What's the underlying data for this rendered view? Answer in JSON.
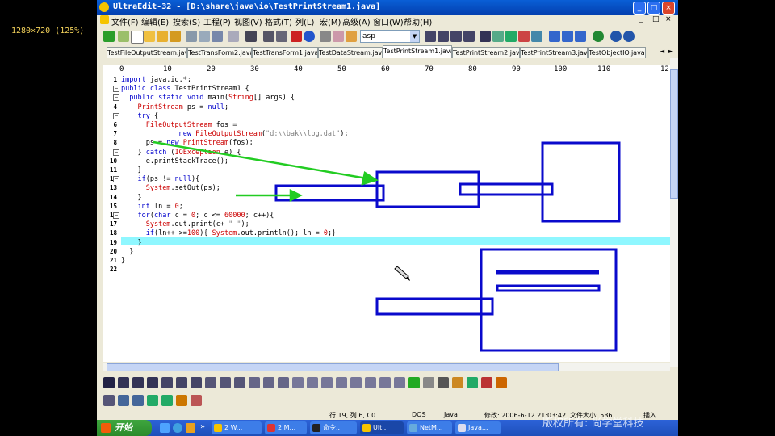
{
  "screen_info": "1280×720 (125%)",
  "window": {
    "title": "UltraEdit-32 - [D:\\share\\java\\io\\TestPrintStream1.java]",
    "controls": [
      "_",
      "□",
      "×"
    ]
  },
  "menu": [
    "文件(F)",
    "编辑(E)",
    "搜索(S)",
    "工程(P)",
    "视图(V)",
    "格式(T)",
    "列(L)",
    "宏(M)",
    "高级(A)",
    "窗口(W)",
    "帮助(H)"
  ],
  "mdi_controls": [
    "_",
    "□",
    "×"
  ],
  "toolbar": {
    "combo_value": "asp"
  },
  "tabs": [
    {
      "label": "TestFileOutputStream.java",
      "active": false
    },
    {
      "label": "TestTransForm2.java",
      "active": false
    },
    {
      "label": "TestTransForm1.java",
      "active": false
    },
    {
      "label": "TestDataStream.java",
      "active": false
    },
    {
      "label": "TestPrintStream1.java",
      "active": true
    },
    {
      "label": "TestPrintStream2.java",
      "active": false
    },
    {
      "label": "TestPrintStream3.java",
      "active": false
    },
    {
      "label": "TestObjectIO.java",
      "active": false
    }
  ],
  "tab_nav": [
    "◄",
    "►"
  ],
  "ruler": [
    "0",
    "10",
    "20",
    "30",
    "40",
    "50",
    "60",
    "70",
    "80",
    "90",
    "100",
    "110",
    "12"
  ],
  "code_lines": [
    {
      "n": "1",
      "text": "import java.io.*;"
    },
    {
      "n": "2",
      "text": "public class TestPrintStream1 {"
    },
    {
      "n": "3",
      "text": "  public static void main(String[] args) {"
    },
    {
      "n": "4",
      "text": "    PrintStream ps = null;"
    },
    {
      "n": "5",
      "text": "    try {"
    },
    {
      "n": "6",
      "text": "      FileOutputStream fos ="
    },
    {
      "n": "7",
      "text": "              new FileOutputStream(\"d:\\\\bak\\\\log.dat\");"
    },
    {
      "n": "8",
      "text": "      ps = new PrintStream(fos);"
    },
    {
      "n": "9",
      "text": "    } catch (IOException e) {"
    },
    {
      "n": "10",
      "text": "      e.printStackTrace();"
    },
    {
      "n": "11",
      "text": "    }"
    },
    {
      "n": "12",
      "text": "    if(ps != null){"
    },
    {
      "n": "13",
      "text": "      System.setOut(ps);"
    },
    {
      "n": "14",
      "text": "    }"
    },
    {
      "n": "15",
      "text": "    int ln = 0;"
    },
    {
      "n": "16",
      "text": "    for(char c = 0; c <= 60000; c++){"
    },
    {
      "n": "17",
      "text": "      System.out.print(c+ \" \");"
    },
    {
      "n": "18",
      "text": "      if(ln++ >=100){ System.out.println(); ln = 0;}"
    },
    {
      "n": "19",
      "text": "    }"
    },
    {
      "n": "20",
      "text": "  }"
    },
    {
      "n": "21",
      "text": "}"
    },
    {
      "n": "22",
      "text": ""
    }
  ],
  "status": {
    "position": "行 19, 列 6, C0",
    "format": "DOS",
    "language": "Java",
    "modified": "修改: 2006-6-12 21:03:42",
    "filesize": "文件大小: 536",
    "mode": "插入"
  },
  "taskbar": {
    "start": "开始",
    "quicklaunch_expand": "»",
    "tasks": [
      {
        "label": "2 W...",
        "active": false
      },
      {
        "label": "2 M...",
        "active": false
      },
      {
        "label": "命令...",
        "active": false
      },
      {
        "label": "Ult...",
        "active": true
      },
      {
        "label": "NetM...",
        "active": false
      },
      {
        "label": "Java...",
        "active": false
      }
    ]
  },
  "watermark": "版权所有: 尚学堂科技",
  "colors": {
    "keyword": "#0000cc",
    "type": "#cc0000",
    "string": "#808080",
    "annotation_blue": "#0a0acc",
    "annotation_green": "#22cc22",
    "highlight_line": "#8ff7ff"
  }
}
